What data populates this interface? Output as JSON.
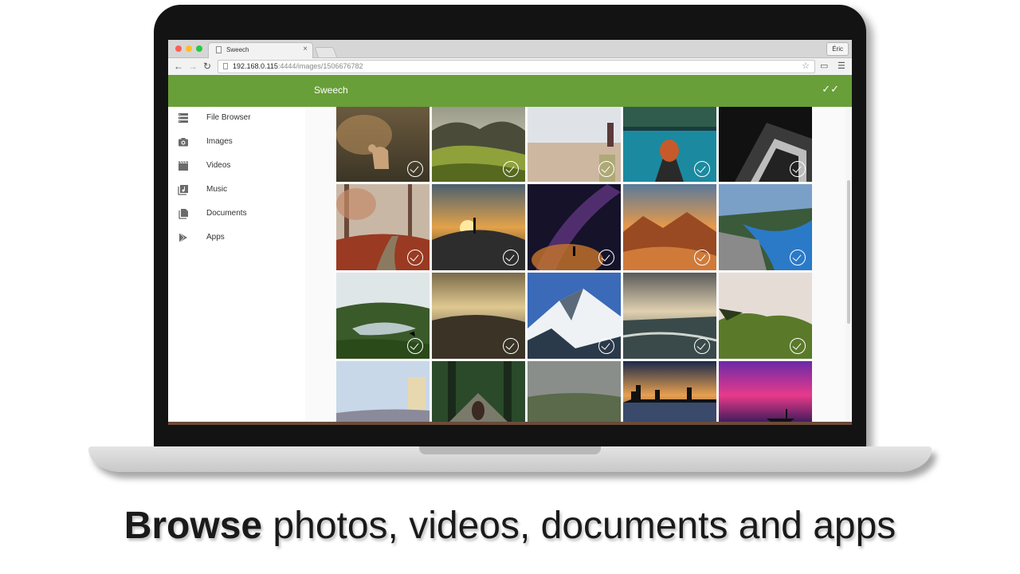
{
  "browser": {
    "tab_title": "Sweech",
    "tab_close": "×",
    "user_button": "Éric",
    "url_host": "192.168.0.115",
    "url_rest": ":4444/images/1506676782"
  },
  "app": {
    "title": "Sweech",
    "select_all_icon": "double-check-icon"
  },
  "sidebar": {
    "items": [
      {
        "label": "File Browser",
        "icon": "file-browser-icon"
      },
      {
        "label": "Images",
        "icon": "camera-icon"
      },
      {
        "label": "Videos",
        "icon": "film-icon"
      },
      {
        "label": "Music",
        "icon": "music-library-icon"
      },
      {
        "label": "Documents",
        "icon": "document-icon"
      },
      {
        "label": "Apps",
        "icon": "play-store-icon"
      }
    ]
  },
  "caption": {
    "bold": "Browse",
    "rest": " photos, videos, documents and apps"
  },
  "colors": {
    "appbar": "#689f38",
    "accent_text": "#ffffff"
  }
}
